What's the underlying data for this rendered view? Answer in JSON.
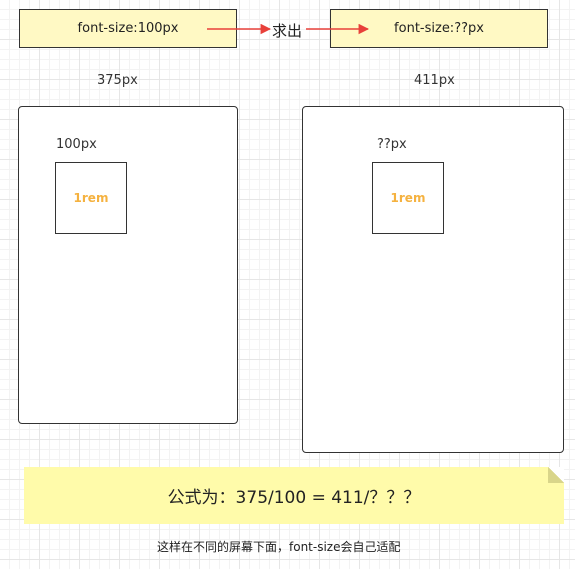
{
  "top": {
    "left_box": "font-size:100px",
    "right_box": "font-size:??px",
    "arrow_label": "求出"
  },
  "left_screen": {
    "width_label": "375px",
    "size_label": "100px",
    "rem_label": "1rem"
  },
  "right_screen": {
    "width_label": "411px",
    "size_label": "??px",
    "rem_label": "1rem"
  },
  "formula": "公式为：375/100 = 411/？？？",
  "caption": "这样在不同的屏幕下面，font-size会自己适配",
  "colors": {
    "arrow": "#e8403a",
    "box_fill": "#fff9c4",
    "note_fill": "#fffbaa",
    "rem_text": "#f5b240"
  }
}
